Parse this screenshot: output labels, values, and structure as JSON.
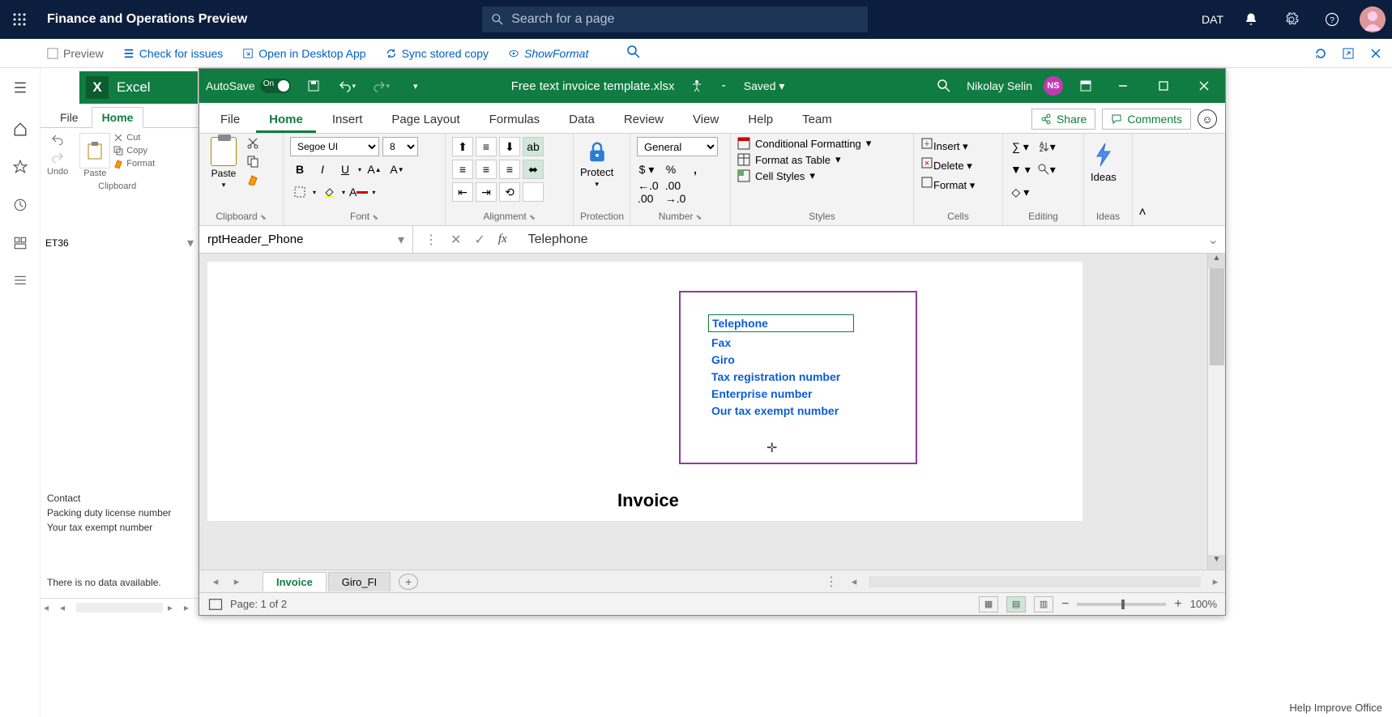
{
  "d365": {
    "title": "Finance and Operations Preview",
    "search_placeholder": "Search for a page",
    "company": "DAT",
    "cmdbar": {
      "preview": "Preview",
      "check": "Check for issues",
      "open_desktop": "Open in Desktop App",
      "sync": "Sync stored copy",
      "show_format": "ShowFormat"
    },
    "preview_panel": {
      "tabs": {
        "file": "File",
        "home": "Home"
      },
      "groups": {
        "undo": "Undo",
        "clipboard": "Clipboard"
      },
      "clip": {
        "cut": "Cut",
        "copy": "Copy",
        "format": "Format"
      },
      "paste": "Paste",
      "namebox": "ET36",
      "lines": {
        "contact": "Contact",
        "packing": "Packing duty license number",
        "tax": "Your tax exempt number"
      },
      "nodata": "There is no data available."
    }
  },
  "excel": {
    "autosave": "AutoSave",
    "autosave_state": "On",
    "filename": "Free text invoice template.xlsx",
    "saved": "Saved",
    "user": "Nikolay Selin",
    "user_initials": "NS",
    "tabs": [
      "File",
      "Home",
      "Insert",
      "Page Layout",
      "Formulas",
      "Data",
      "Review",
      "View",
      "Help",
      "Team"
    ],
    "active_tab": "Home",
    "share": "Share",
    "comments": "Comments",
    "ribbon_groups": {
      "clipboard": "Clipboard",
      "paste": "Paste",
      "font": "Font",
      "font_name": "Segoe UI",
      "font_size": "8",
      "alignment": "Alignment",
      "protection": "Protection",
      "protect": "Protect",
      "number": "Number",
      "number_format": "General",
      "styles": "Styles",
      "cond_fmt": "Conditional Formatting",
      "as_table": "Format as Table",
      "cell_styles": "Cell Styles",
      "cells": "Cells",
      "insert": "Insert",
      "delete": "Delete",
      "format": "Format",
      "editing": "Editing",
      "ideas": "Ideas"
    },
    "name_box": "rptHeader_Phone",
    "formula_bar": "Telephone",
    "header_fields": [
      "Telephone",
      "Fax",
      "Giro",
      "Tax registration number",
      "Enterprise number",
      "Our tax exempt number"
    ],
    "doc_title": "Invoice",
    "sheet_tabs": [
      "Invoice",
      "Giro_FI"
    ],
    "active_sheet": "Invoice",
    "page_indicator": "Page: 1 of 2",
    "zoom": "100%"
  },
  "footer": {
    "help": "Help Improve Office"
  }
}
